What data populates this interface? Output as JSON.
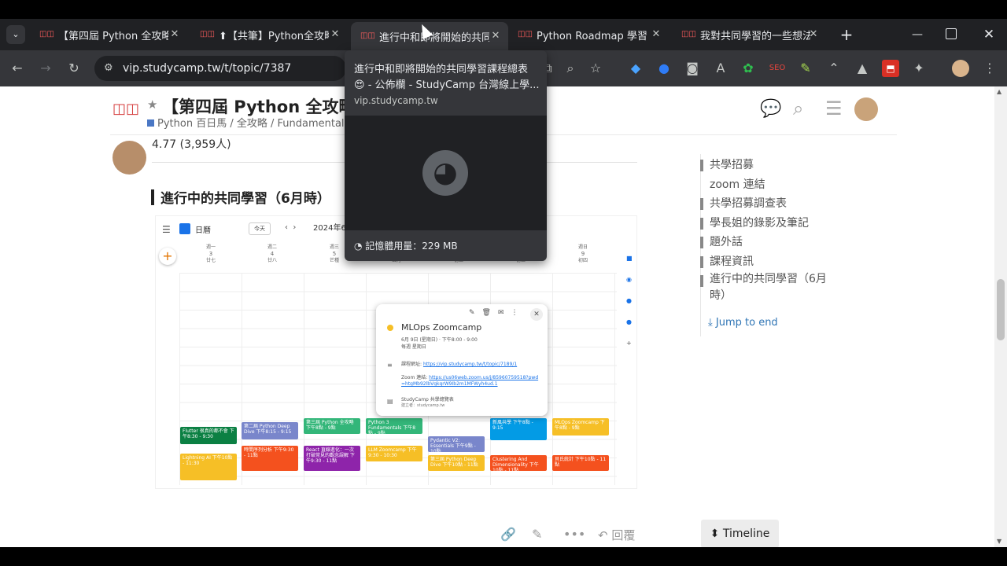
{
  "browser": {
    "tabs": [
      {
        "label": "【第四屆 Python 全攻略",
        "active": false
      },
      {
        "label": "⬆【共筆】Python全攻略",
        "active": false
      },
      {
        "label": "進行中和即將開始的共同",
        "active": true
      },
      {
        "label": "Python Roadmap 學習路",
        "active": false
      },
      {
        "label": "我對共同學習的一些想法",
        "active": false
      }
    ],
    "url": "vip.studycamp.tw/t/topic/7387"
  },
  "tooltip": {
    "title": "進行中和即將開始的共同學習課程總表",
    "subtitle": "- 公佈欄 - StudyCamp 台灣線上學...",
    "emoji": "😍",
    "domain": "vip.studycamp.tw",
    "memory": "記憶體用量：229 MB"
  },
  "topic": {
    "title": "【第四屆 Python 全攻略",
    "breadcrumb": "Python 百日馬 / 全攻略 / Fundamentals",
    "rating": "4.77 (3,959人)",
    "section_heading": "進行中的共同學習（6月時）"
  },
  "sidebar": {
    "toc": [
      {
        "label": "共學招募",
        "bar": true
      },
      {
        "label": "zoom 連結",
        "bar": false
      },
      {
        "label": "共學招募調查表",
        "bar": true
      },
      {
        "label": "學長姐的錄影及筆記",
        "bar": true
      },
      {
        "label": "題外話",
        "bar": true
      },
      {
        "label": "課程資訊",
        "bar": true
      },
      {
        "label": "進行中的共同學習（6月時）",
        "bar": true
      }
    ],
    "jump": "Jump to end",
    "timeline": "Timeline"
  },
  "post_actions": {
    "reply": "回覆"
  },
  "calendar": {
    "app_title": "日曆",
    "today_btn": "今天",
    "date_label": "2024年6",
    "days": [
      {
        "name": "週一",
        "num": "3",
        "sub": "廿七"
      },
      {
        "name": "週二",
        "num": "4",
        "sub": "廿八"
      },
      {
        "name": "週三",
        "num": "5",
        "sub": "芒種"
      },
      {
        "name": "週四",
        "num": "6",
        "sub": "五月"
      },
      {
        "name": "週五",
        "num": "7",
        "sub": "初二"
      },
      {
        "name": "週六",
        "num": "8",
        "sub": "初三"
      },
      {
        "name": "週日",
        "num": "9",
        "sub": "初四"
      }
    ],
    "events": [
      {
        "t": "Flutter 很真的都不會 下午8:30 - 9:30",
        "c": "#0b8043"
      },
      {
        "t": "Lightning AI 下午10點 - 11:30",
        "c": "#f6bf26"
      },
      {
        "t": "第二屆 Python Deep Dive 下午8:15 - 9:15",
        "c": "#7986cb"
      },
      {
        "t": "時間序列分析 下午9:30 - 11點",
        "c": "#f4511e"
      },
      {
        "t": "第三屆 Python 全攻略 下午8點 - 9點",
        "c": "#33b679"
      },
      {
        "t": "React 直線進化：一次打破常見的觀念誤解 下午9:30 - 11點",
        "c": "#8e24aa"
      },
      {
        "t": "Python 3 Fundamentals 下午8點 - 9點",
        "c": "#33b679"
      },
      {
        "t": "LLM Zoomcamp 下午9:30 - 10:30",
        "c": "#f6bf26"
      },
      {
        "t": "Pydantic V2: Essentials 下午9點 - 10點",
        "c": "#7986cb"
      },
      {
        "t": "第三屆 Python Deep Dive 下午10點 - 11點",
        "c": "#f6bf26"
      },
      {
        "t": "新風共學 下午8點 - 9:15",
        "c": "#039be5"
      },
      {
        "t": "Clustering And Dimensionality 下午10點 - 11點",
        "c": "#f4511e"
      },
      {
        "t": "MLOps Zoomcamp 下午8點 - 9點",
        "c": "#f6bf26"
      },
      {
        "t": "貝氏統計 下午10點 - 11點",
        "c": "#f4511e"
      }
    ],
    "popup": {
      "title": "MLOps Zoomcamp",
      "date": "6月 9日 (星期日) · 下午8:00 - 9:00",
      "repeat": "每週 星期日",
      "link_label": "課程網址:",
      "link": "https://vip.studycamp.tw/t/topic/7189/1",
      "zoom_label": "Zoom 連結:",
      "zoom": "https://us06web.zoom.us/j/85960759518?pwd=htgMb92lbVgkqrW9Ib2m1MFWyh4ud.1",
      "calendar_name": "StudyCamp 共學總覽表",
      "creator": "建立者：studycamp.tw"
    }
  },
  "colors": {
    "tabbar": "#202124",
    "toolbar": "#35363a",
    "accent": "#2f75b5"
  }
}
